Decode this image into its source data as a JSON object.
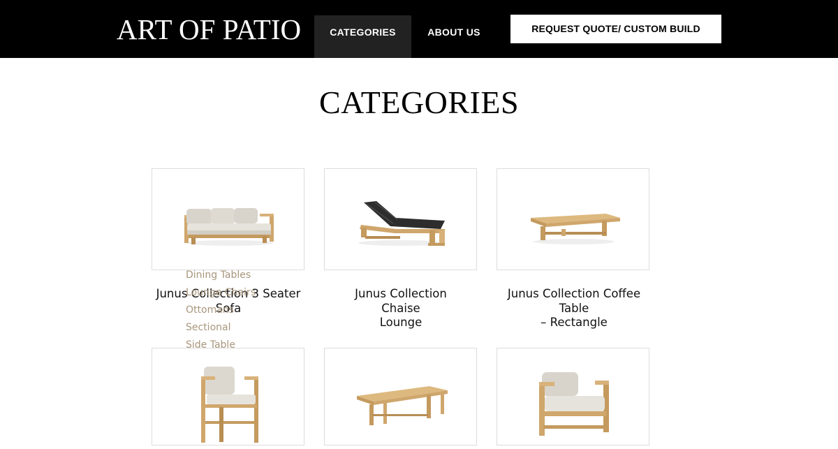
{
  "header": {
    "logo": "ART OF PATIO",
    "nav": {
      "categories": "CATEGORIES",
      "about": "ABOUT US",
      "quote_button": "REQUEST QUOTE/ CUSTOM BUILD"
    }
  },
  "page_title": "CATEGORIES",
  "dropdown_items": [
    "Dining Tables",
    "Lounge Chairs",
    "Ottomans",
    "Sectional",
    "Side Table"
  ],
  "products": [
    {
      "title_line1": "Junus Collection 3 Seater",
      "title_line2": "Sofa",
      "title_line3": ""
    },
    {
      "title_line1": "Junus Collection",
      "title_line2": "Chaise",
      "title_line3": "Lounge"
    },
    {
      "title_line1": "Junus Collection Coffee",
      "title_line2": "Table",
      "title_line3": "– Rectangle"
    }
  ],
  "colors": {
    "header_bg": "#000000",
    "active_nav_bg": "#222222",
    "dropdown_text": "#a8967c",
    "teak": "#c9a46a",
    "cushion": "#dcd8cf"
  }
}
